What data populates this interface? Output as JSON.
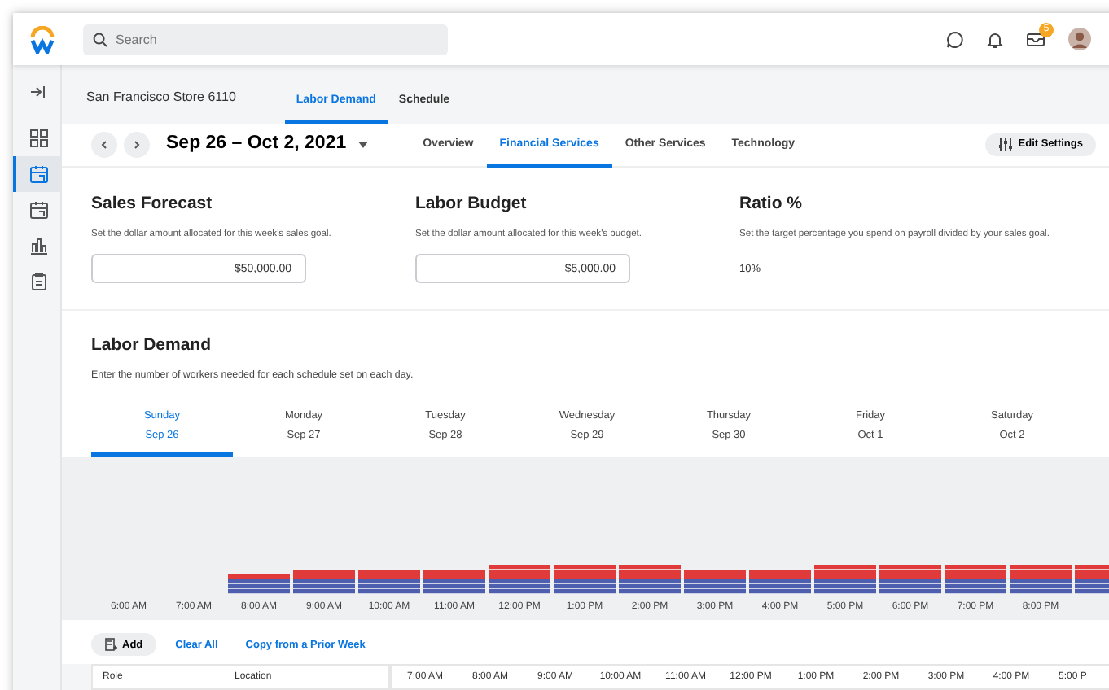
{
  "header": {
    "search": {
      "placeholder": "Search"
    },
    "inbox_badge": "5"
  },
  "sidebar": {
    "items": [
      {
        "kind": "grid",
        "selected": false
      },
      {
        "kind": "calendar",
        "selected": true
      },
      {
        "kind": "calendar",
        "selected": false
      },
      {
        "kind": "chart",
        "selected": false
      },
      {
        "kind": "clipboard",
        "selected": false
      }
    ]
  },
  "store": {
    "title": "San Francisco Store 6110",
    "tabs": [
      {
        "label": "Labor Demand",
        "selected": true
      },
      {
        "label": "Schedule",
        "selected": false
      }
    ]
  },
  "week": {
    "range": "Sep 26 – Oct 2, 2021",
    "tabs": [
      {
        "label": "Overview",
        "selected": false
      },
      {
        "label": "Financial Services",
        "selected": true
      },
      {
        "label": "Other Services",
        "selected": false
      },
      {
        "label": "Technology",
        "selected": false
      }
    ],
    "settings_button": "Edit Settings"
  },
  "goals": [
    {
      "kind": "input",
      "title": "Sales Forecast",
      "description": "Set the dollar amount allocated for this week's sales goal.",
      "value": "$50,000.00"
    },
    {
      "kind": "input",
      "title": "Labor Budget",
      "description": "Set the dollar amount allocated for this week's budget.",
      "value": "$5,000.00"
    },
    {
      "kind": "text",
      "title": "Ratio %",
      "description": "Set the target percentage you spend on payroll divided by your sales goal.",
      "value": "10%"
    }
  ],
  "labor_demand": {
    "title": "Labor Demand",
    "description": "Enter the number of workers needed for each schedule set on each day.",
    "days": [
      {
        "day": "Sunday",
        "date": "Sep 26",
        "selected": true
      },
      {
        "day": "Monday",
        "date": "Sep 27",
        "selected": false
      },
      {
        "day": "Tuesday",
        "date": "Sep 28",
        "selected": false
      },
      {
        "day": "Wednesday",
        "date": "Sep 29",
        "selected": false
      },
      {
        "day": "Thursday",
        "date": "Sep 30",
        "selected": false
      },
      {
        "day": "Friday",
        "date": "Oct 1",
        "selected": false
      },
      {
        "day": "Saturday",
        "date": "Oct 2",
        "selected": false
      }
    ],
    "hours": [
      "6:00 AM",
      "7:00 AM",
      "8:00 AM",
      "9:00 AM",
      "10:00 AM",
      "11:00 AM",
      "12:00 PM",
      "1:00 PM",
      "2:00 PM",
      "3:00 PM",
      "4:00 PM",
      "5:00 PM",
      "6:00 PM",
      "7:00 PM",
      "8:00 PM"
    ],
    "actions": [
      {
        "kind": "button",
        "label": "Add"
      },
      {
        "kind": "link",
        "label": "Clear All"
      },
      {
        "kind": "link",
        "label": "Copy from a Prior Week"
      }
    ],
    "table": {
      "columns": [
        "Role",
        "Location"
      ],
      "hours": [
        "7:00 AM",
        "8:00 AM",
        "9:00 AM",
        "10:00 AM",
        "11:00 AM",
        "12:00 PM",
        "1:00 PM",
        "2:00 PM",
        "3:00 PM",
        "4:00 PM",
        "5:00 P"
      ]
    }
  }
}
